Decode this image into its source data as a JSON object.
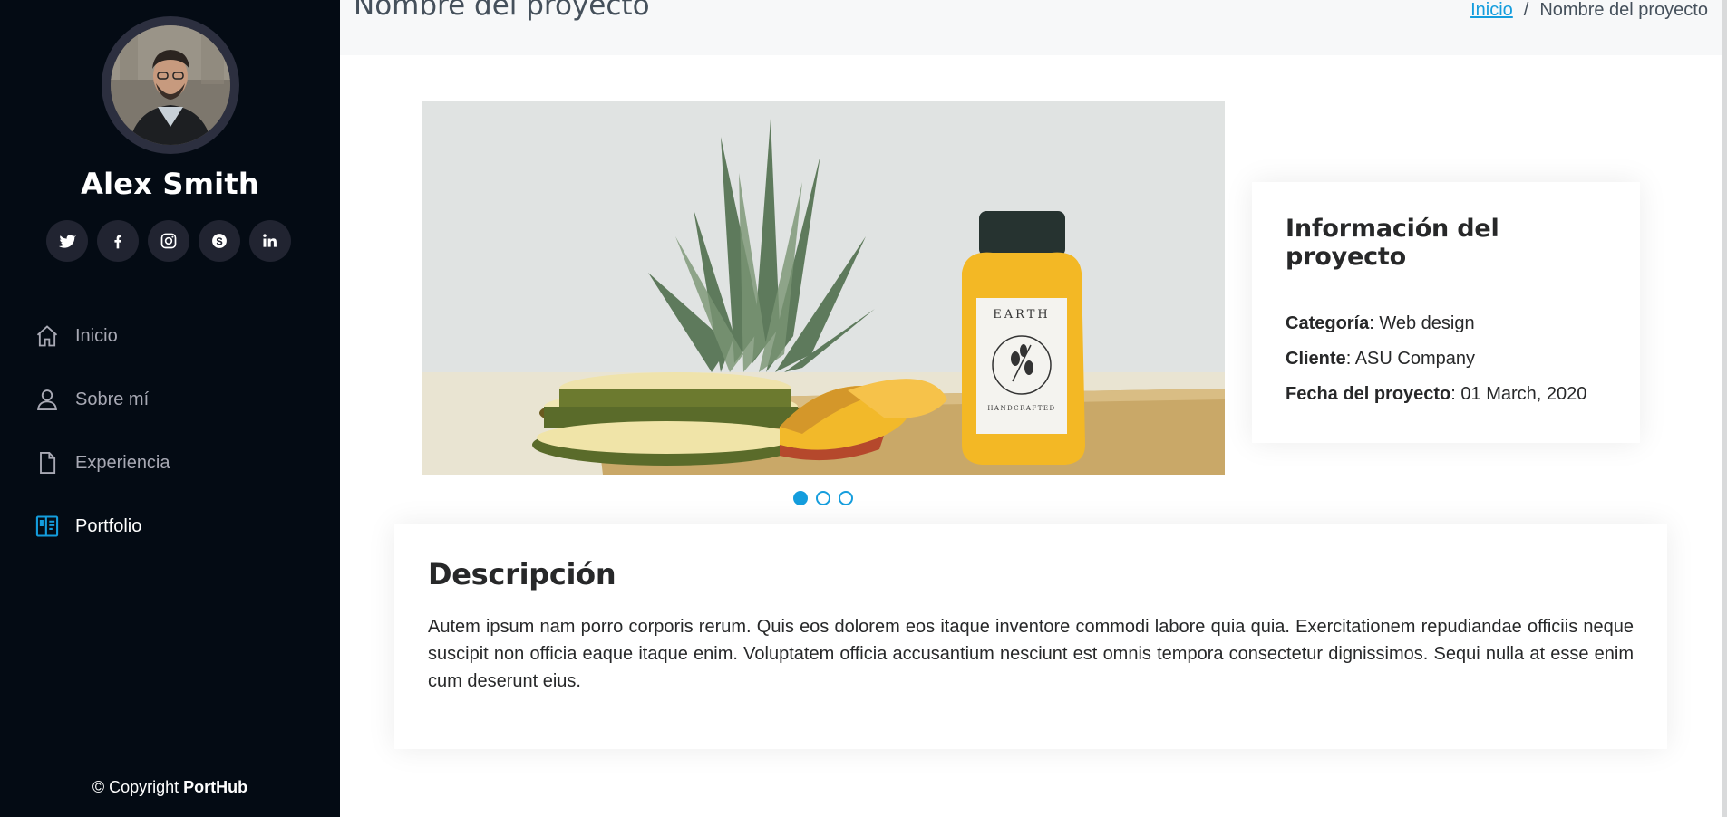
{
  "sidebar": {
    "name": "Alex Smith",
    "social": [
      {
        "icon": "twitter-icon"
      },
      {
        "icon": "facebook-icon"
      },
      {
        "icon": "instagram-icon"
      },
      {
        "icon": "skype-icon"
      },
      {
        "icon": "linkedin-icon"
      }
    ],
    "nav": [
      {
        "label": "Inicio",
        "icon": "home-icon",
        "active": false
      },
      {
        "label": "Sobre mí",
        "icon": "person-icon",
        "active": false
      },
      {
        "label": "Experiencia",
        "icon": "file-icon",
        "active": false
      },
      {
        "label": "Portfolio",
        "icon": "layout-icon",
        "active": true
      }
    ],
    "copyright_prefix": "© Copyright",
    "copyright_brand": "PortHub"
  },
  "breadcrumbs": {
    "title": "Nombre del proyecto",
    "home_link": "Inicio",
    "separator": "/",
    "current": "Nombre del proyecto"
  },
  "carousel": {
    "slides": 3,
    "active_slide": 1,
    "bottle_label": "EARTH",
    "bottle_sublabel": "HANDCRAFTED"
  },
  "info": {
    "title": "Información del proyecto",
    "category_label": "Categoría",
    "category_value": ": Web design",
    "client_label": "Cliente",
    "client_value": ": ASU Company",
    "date_label": "Fecha del proyecto",
    "date_value": ": 01 March, 2020"
  },
  "description": {
    "title": "Descripción",
    "text": "Autem ipsum nam porro corporis rerum. Quis eos dolorem eos itaque inventore commodi labore quia quia. Exercitationem repudiandae officiis neque suscipit non officia eaque itaque enim. Voluptatem officia accusantium nesciunt est omnis tempora consectetur dignissimos. Sequi nulla at esse enim cum deserunt eius."
  },
  "colors": {
    "accent": "#149ddd",
    "sidebar_bg": "#040b14",
    "social_bg": "#212431",
    "nav_text": "#a8a9b4"
  }
}
